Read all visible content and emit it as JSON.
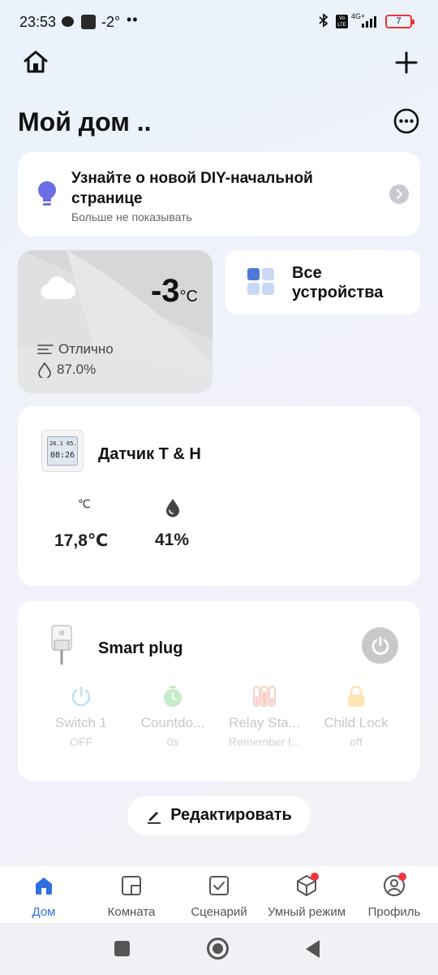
{
  "status_bar": {
    "time": "23:53",
    "temperature": "-2°",
    "dots": "••",
    "network": "4G+",
    "battery": "7"
  },
  "header": {
    "title": "Мой дом .."
  },
  "promo": {
    "title": "Узнайте о новой DIY-начальной странице",
    "subtitle": "Больше не показывать"
  },
  "weather": {
    "temperature": "-3",
    "unit": "°C",
    "condition": "Отлично",
    "humidity": "87.0%"
  },
  "all_devices": {
    "label_line1": "Все",
    "label_line2": "устройства"
  },
  "sensor": {
    "name": "Датчик T & H",
    "screen_line1": "26.1 65.",
    "screen_line2": "08:26",
    "temp_unit": "℃",
    "temperature": "17,8℃",
    "humidity": "41%"
  },
  "plug": {
    "name": "Smart plug",
    "functions": [
      {
        "label": "Switch 1",
        "value": "OFF",
        "icon": "power-icon"
      },
      {
        "label": "Countdo...",
        "value": "0s",
        "icon": "timer-icon"
      },
      {
        "label": "Relay Sta...",
        "value": "Remember l...",
        "icon": "relay-icon"
      },
      {
        "label": "Child Lock",
        "value": "off",
        "icon": "lock-icon"
      }
    ]
  },
  "edit_button": {
    "label": "Редактировать"
  },
  "tabs": [
    {
      "label": "Дом",
      "icon": "home-icon",
      "active": true
    },
    {
      "label": "Комната",
      "icon": "room-icon"
    },
    {
      "label": "Сценарий",
      "icon": "scenario-icon"
    },
    {
      "label": "Умный режим",
      "icon": "smart-mode-icon",
      "badge": true
    },
    {
      "label": "Профиль",
      "icon": "profile-icon",
      "badge": true
    }
  ],
  "colors": {
    "accent": "#2f6fe0",
    "badge": "#f0343e",
    "bulb": "#6b6fe3"
  }
}
